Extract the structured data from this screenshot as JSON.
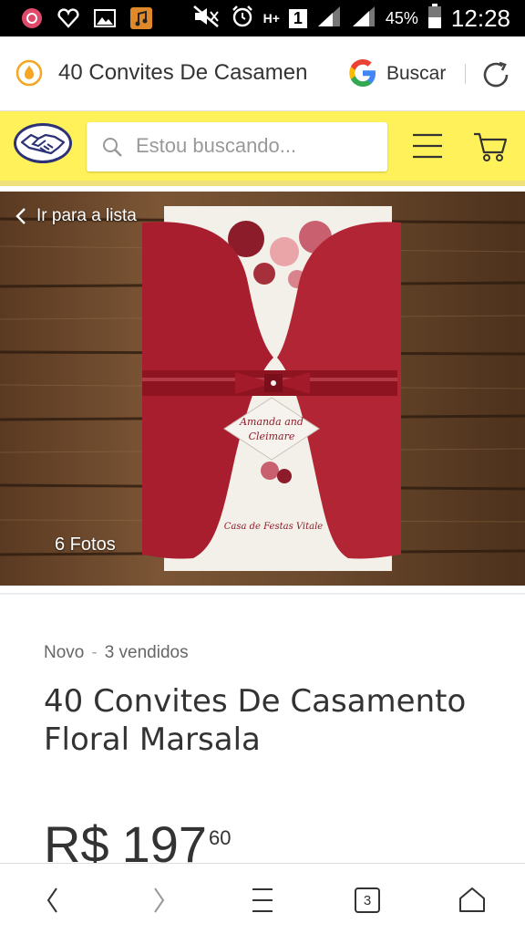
{
  "status_bar": {
    "battery_percent": "45%",
    "time": "12:28",
    "network_label": "H+",
    "sim_label": "1",
    "icons": [
      "app-notification-icon",
      "heart-app-icon",
      "gallery-icon",
      "music-icon",
      "mute-icon",
      "alarm-icon",
      "signal-icon",
      "battery-icon"
    ]
  },
  "browser": {
    "page_title": "40 Convites De Casamen",
    "search_label": "Buscar"
  },
  "header": {
    "search_placeholder": "Estou buscando...",
    "brand_color": "#fff159"
  },
  "gallery": {
    "back_label": "Ir para a lista",
    "photos_label": "6 Fotos",
    "card_text_1": "Amanda and",
    "card_text_2": "Cleimare",
    "card_text_3": "Casa de Festas Vitale"
  },
  "product": {
    "condition": "Novo",
    "sold": "3 vendidos",
    "title": "40 Convites De Casamento Floral Marsala",
    "currency": "R$",
    "price_int": "197",
    "price_cents": "60"
  },
  "nav": {
    "tab_count": "3"
  }
}
